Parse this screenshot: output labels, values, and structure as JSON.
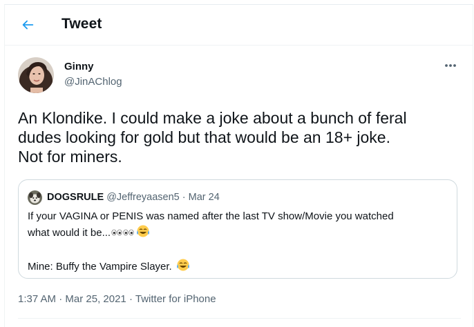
{
  "header": {
    "title": "Tweet",
    "back_icon": "arrow-left-icon",
    "accent_color": "#1d9bf0"
  },
  "tweet": {
    "display_name": "Ginny",
    "handle": "@JinAChlog",
    "more_icon": "more-horizontal-icon",
    "text": "An Klondike. I could make a joke about a bunch of feral\ndudes looking for gold but that would be an 18+ joke.\nNot for miners.",
    "quoted": {
      "name": "DOGSRULE",
      "handle": "@Jeffreyaasen5",
      "separator": "·",
      "date": "Mar 24",
      "line1": "If your VAGINA or PENIS was named after the last TV show/Movie you watched",
      "line2": "what would it be...",
      "line3": "Mine: Buffy the Vampire Slayer.",
      "eyes_icon": "eyes-emoji-icon",
      "laugh_icon": "tears-of-joy-emoji-icon"
    },
    "time": "1:37 AM",
    "date": "Mar 25, 2021",
    "source": "Twitter for iPhone",
    "dot": "·"
  }
}
